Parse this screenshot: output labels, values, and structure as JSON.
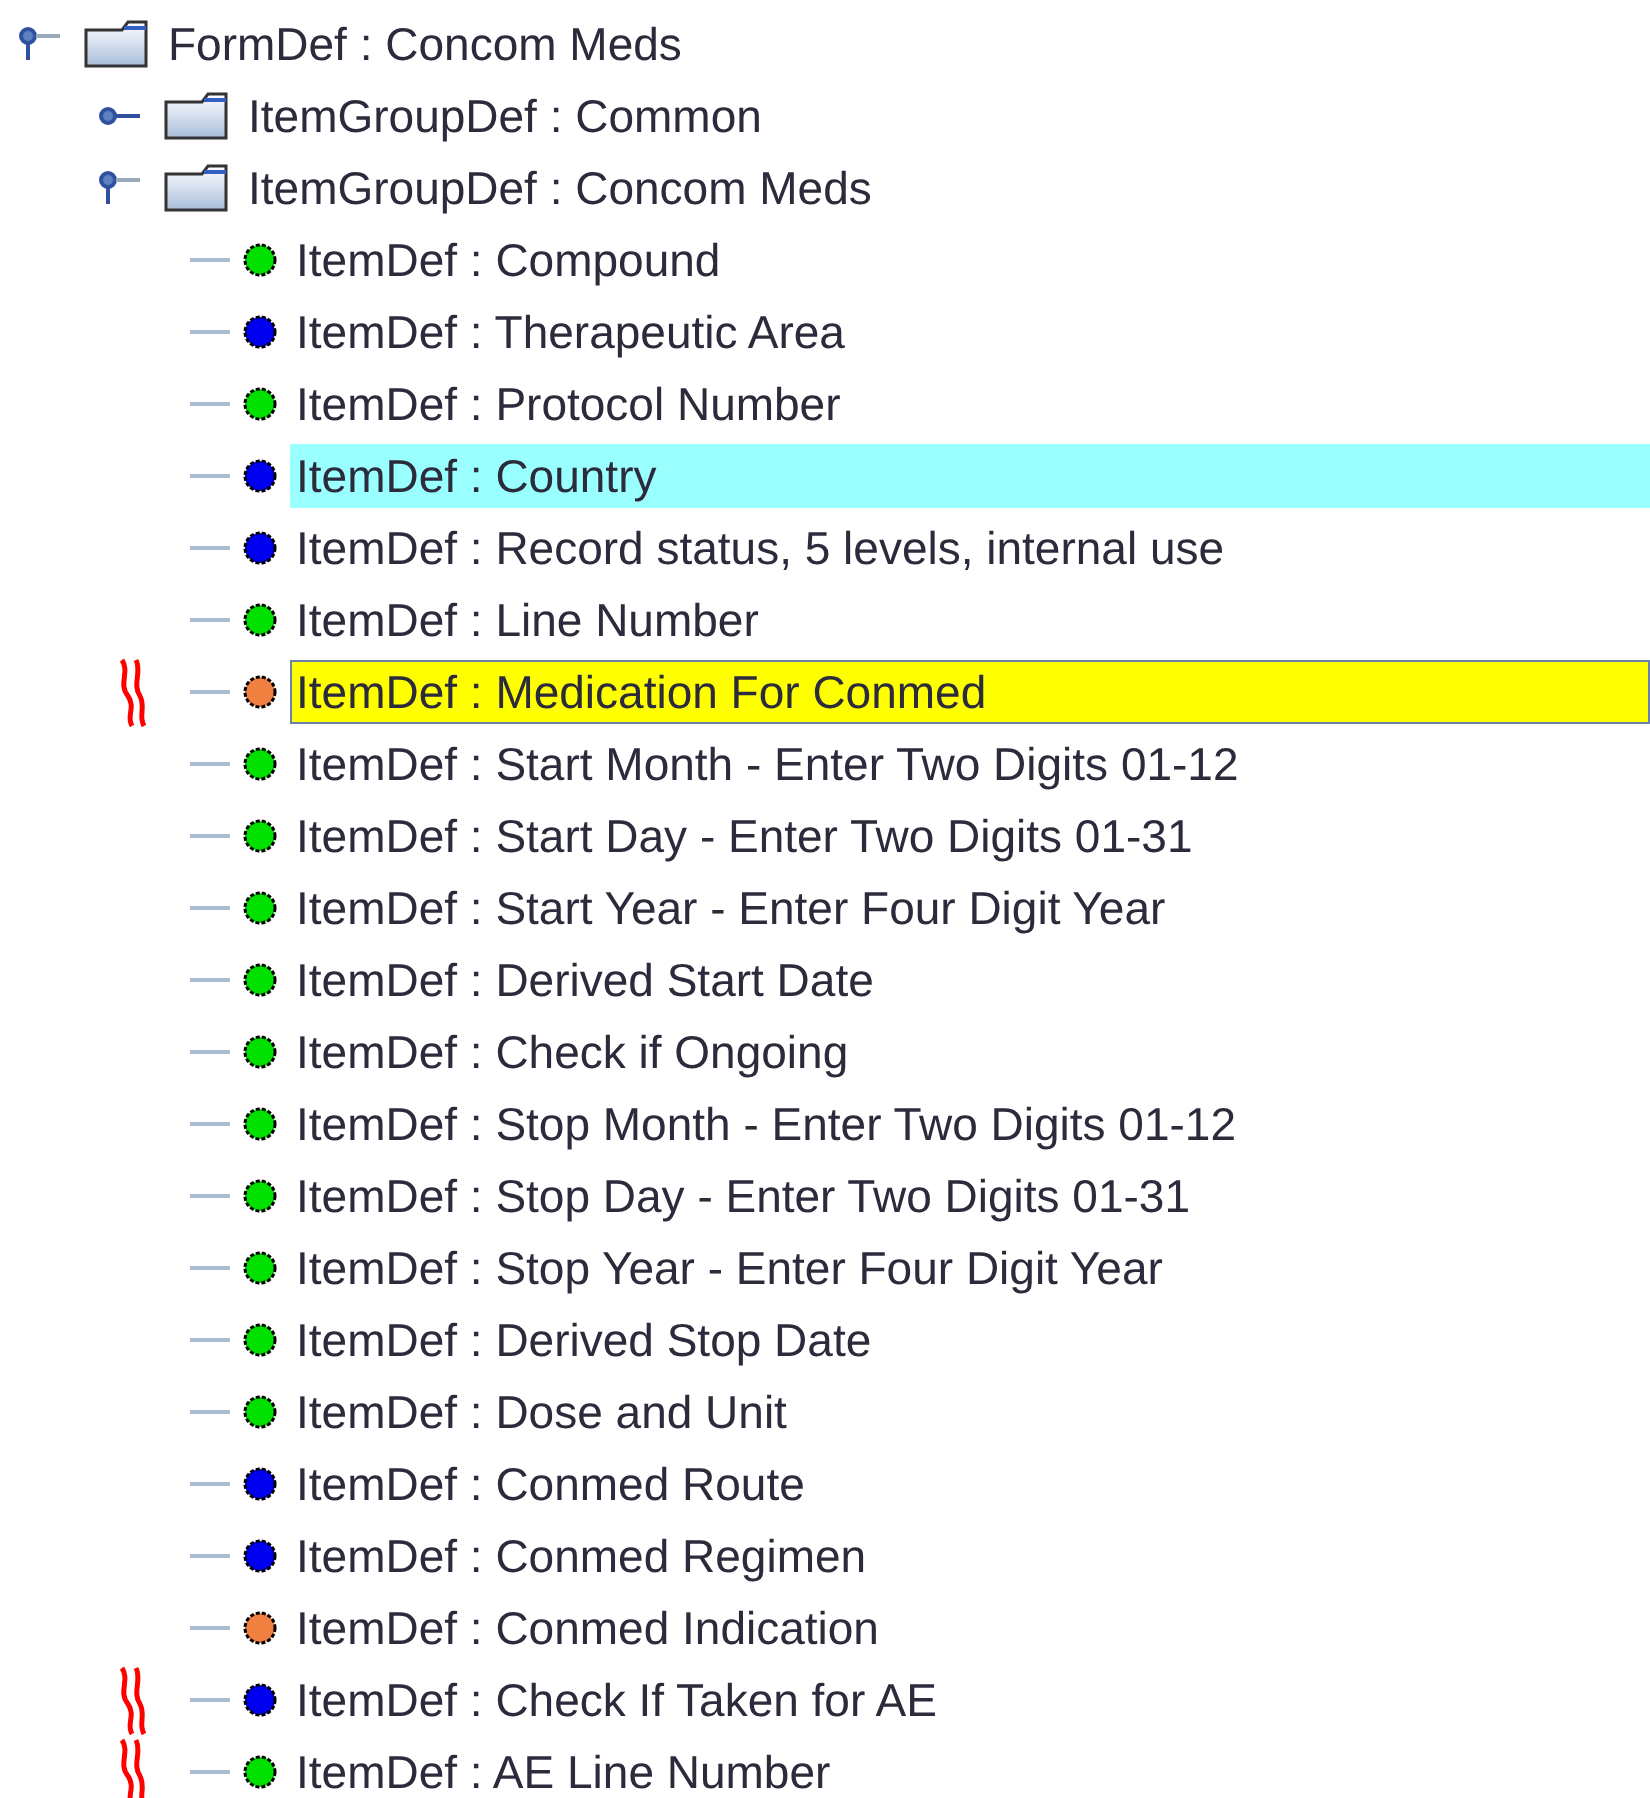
{
  "tree": [
    {
      "kind": "folder",
      "label": "FormDef : Concom Meds",
      "expanded": true,
      "children": [
        {
          "kind": "folder",
          "label": "ItemGroupDef : Common",
          "expanded": false
        },
        {
          "kind": "folder",
          "label": "ItemGroupDef : Concom Meds",
          "expanded": true,
          "children": [
            {
              "kind": "item",
              "label": "ItemDef : Compound",
              "color": "#00e000",
              "selected": false,
              "flagged": false,
              "annotated": false
            },
            {
              "kind": "item",
              "label": "ItemDef : Therapeutic Area",
              "color": "#0000f0",
              "selected": false,
              "flagged": false,
              "annotated": false
            },
            {
              "kind": "item",
              "label": "ItemDef : Protocol Number",
              "color": "#00e000",
              "selected": false,
              "flagged": false,
              "annotated": false
            },
            {
              "kind": "item",
              "label": "ItemDef : Country",
              "color": "#0000f0",
              "selected": true,
              "flagged": false,
              "annotated": false
            },
            {
              "kind": "item",
              "label": "ItemDef : Record status, 5 levels, internal use",
              "color": "#0000f0",
              "selected": false,
              "flagged": false,
              "annotated": false
            },
            {
              "kind": "item",
              "label": "ItemDef : Line Number",
              "color": "#00e000",
              "selected": false,
              "flagged": false,
              "annotated": false
            },
            {
              "kind": "item",
              "label": "ItemDef : Medication For Conmed",
              "color": "#f08040",
              "selected": false,
              "flagged": true,
              "annotated": true
            },
            {
              "kind": "item",
              "label": "ItemDef : Start Month - Enter Two Digits 01-12",
              "color": "#00e000",
              "selected": false,
              "flagged": false,
              "annotated": false
            },
            {
              "kind": "item",
              "label": "ItemDef : Start Day - Enter Two Digits 01-31",
              "color": "#00e000",
              "selected": false,
              "flagged": false,
              "annotated": false
            },
            {
              "kind": "item",
              "label": "ItemDef : Start Year - Enter Four Digit Year",
              "color": "#00e000",
              "selected": false,
              "flagged": false,
              "annotated": false
            },
            {
              "kind": "item",
              "label": "ItemDef : Derived Start Date",
              "color": "#00e000",
              "selected": false,
              "flagged": false,
              "annotated": false
            },
            {
              "kind": "item",
              "label": "ItemDef : Check if Ongoing",
              "color": "#00e000",
              "selected": false,
              "flagged": false,
              "annotated": false
            },
            {
              "kind": "item",
              "label": "ItemDef : Stop Month - Enter Two Digits 01-12",
              "color": "#00e000",
              "selected": false,
              "flagged": false,
              "annotated": false
            },
            {
              "kind": "item",
              "label": "ItemDef : Stop Day - Enter Two Digits 01-31",
              "color": "#00e000",
              "selected": false,
              "flagged": false,
              "annotated": false
            },
            {
              "kind": "item",
              "label": "ItemDef : Stop Year - Enter Four Digit Year",
              "color": "#00e000",
              "selected": false,
              "flagged": false,
              "annotated": false
            },
            {
              "kind": "item",
              "label": "ItemDef : Derived Stop Date",
              "color": "#00e000",
              "selected": false,
              "flagged": false,
              "annotated": false
            },
            {
              "kind": "item",
              "label": "ItemDef : Dose and Unit",
              "color": "#00e000",
              "selected": false,
              "flagged": false,
              "annotated": false
            },
            {
              "kind": "item",
              "label": "ItemDef : Conmed Route",
              "color": "#0000f0",
              "selected": false,
              "flagged": false,
              "annotated": false
            },
            {
              "kind": "item",
              "label": "ItemDef : Conmed Regimen",
              "color": "#0000f0",
              "selected": false,
              "flagged": false,
              "annotated": false
            },
            {
              "kind": "item",
              "label": "ItemDef : Conmed Indication",
              "color": "#f08040",
              "selected": false,
              "flagged": false,
              "annotated": false
            },
            {
              "kind": "item",
              "label": "ItemDef : Check If Taken for AE",
              "color": "#0000f0",
              "selected": false,
              "flagged": false,
              "annotated": true
            },
            {
              "kind": "item",
              "label": "ItemDef : AE Line Number",
              "color": "#00e000",
              "selected": false,
              "flagged": false,
              "annotated": true
            }
          ]
        }
      ]
    }
  ]
}
